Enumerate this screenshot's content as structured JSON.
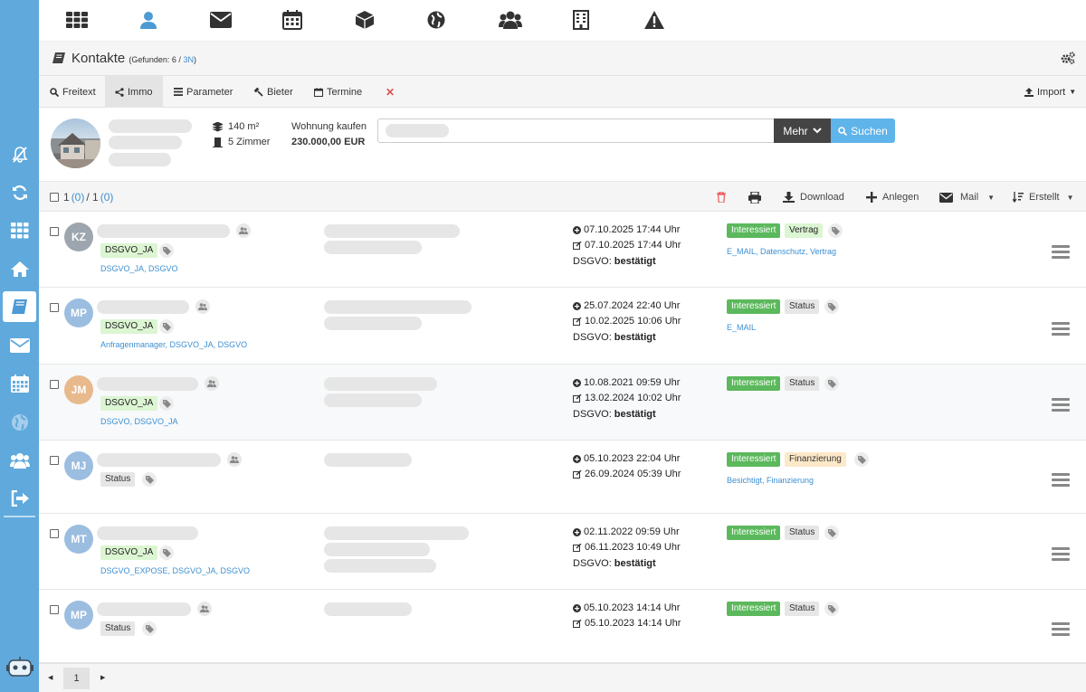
{
  "header": {
    "title": "Kontakte",
    "found_prefix": "(Gefunden: 6 / ",
    "found_link": "3N",
    "found_suffix": ")"
  },
  "tabs": [
    {
      "label": "Freitext",
      "icon": "search-icon"
    },
    {
      "label": "Immo",
      "icon": "share-icon"
    },
    {
      "label": "Parameter",
      "icon": "list-icon"
    },
    {
      "label": "Bieter",
      "icon": "gavel-icon"
    },
    {
      "label": "Termine",
      "icon": "calendar-icon"
    }
  ],
  "import_label": "Import",
  "property": {
    "area": "140 m²",
    "rooms": "5 Zimmer",
    "type": "Wohnung kaufen",
    "price": "230.000,00 EUR"
  },
  "search": {
    "mehr_label": "Mehr",
    "search_label": "Suchen"
  },
  "list": {
    "count_a": "1",
    "count_b": "(0)",
    "count_sep": "/ 1",
    "count_c": "(0)",
    "download": "Download",
    "anlegen": "Anlegen",
    "mail": "Mail",
    "sort": "Erstellt"
  },
  "rows": [
    {
      "initials": "KZ",
      "avatar_color": "#9da6ae",
      "tags": [
        "DSGVO_JA"
      ],
      "tags_line": "DSGVO_JA, DSGVO",
      "created": "07.10.2025 17:44 Uhr",
      "edited": "07.10.2025 17:44 Uhr",
      "dsgvo_label": "DSGVO:",
      "dsgvo_value": "bestätigt",
      "status": [
        "Interessiert",
        "Vertrag"
      ],
      "status_line": "E_MAIL, Datenschutz, Vertrag"
    },
    {
      "initials": "MP",
      "avatar_color": "#9bbde0",
      "tags": [
        "DSGVO_JA"
      ],
      "tags_line": "Anfragenmanager, DSGVO_JA, DSGVO",
      "created": "25.07.2024 22:40 Uhr",
      "edited": "10.02.2025 10:06 Uhr",
      "dsgvo_label": "DSGVO:",
      "dsgvo_value": "bestätigt",
      "status": [
        "Interessiert",
        "Status"
      ],
      "status_line": "E_MAIL"
    },
    {
      "initials": "JM",
      "avatar_color": "#e8b98c",
      "tags": [
        "DSGVO_JA"
      ],
      "tags_line": "DSGVO, DSGVO_JA",
      "created": "10.08.2021 09:59 Uhr",
      "edited": "13.02.2024 10:02 Uhr",
      "dsgvo_label": "DSGVO:",
      "dsgvo_value": "bestätigt",
      "status": [
        "Interessiert",
        "Status"
      ],
      "status_line": ""
    },
    {
      "initials": "MJ",
      "avatar_color": "#9bbde0",
      "tags": [
        "Status"
      ],
      "tags_line": "",
      "created": "05.10.2023 22:04 Uhr",
      "edited": "26.09.2024 05:39 Uhr",
      "dsgvo_label": "",
      "dsgvo_value": "",
      "status": [
        "Interessiert",
        "Finanzierung"
      ],
      "status_line": "Besichtigt, Finanzierung"
    },
    {
      "initials": "MT",
      "avatar_color": "#9bbde0",
      "tags": [
        "DSGVO_JA"
      ],
      "tags_line": "DSGVO_EXPOSE, DSGVO_JA, DSGVO",
      "created": "02.11.2022 09:59 Uhr",
      "edited": "06.11.2023 10:49 Uhr",
      "dsgvo_label": "DSGVO:",
      "dsgvo_value": "bestätigt",
      "status": [
        "Interessiert",
        "Status"
      ],
      "status_line": ""
    },
    {
      "initials": "MP",
      "avatar_color": "#9bbde0",
      "tags": [
        "Status"
      ],
      "tags_line": "",
      "created": "05.10.2023 14:14 Uhr",
      "edited": "05.10.2023 14:14 Uhr",
      "dsgvo_label": "",
      "dsgvo_value": "",
      "status": [
        "Interessiert",
        "Status"
      ],
      "status_line": ""
    }
  ],
  "pager": {
    "page": "1"
  }
}
